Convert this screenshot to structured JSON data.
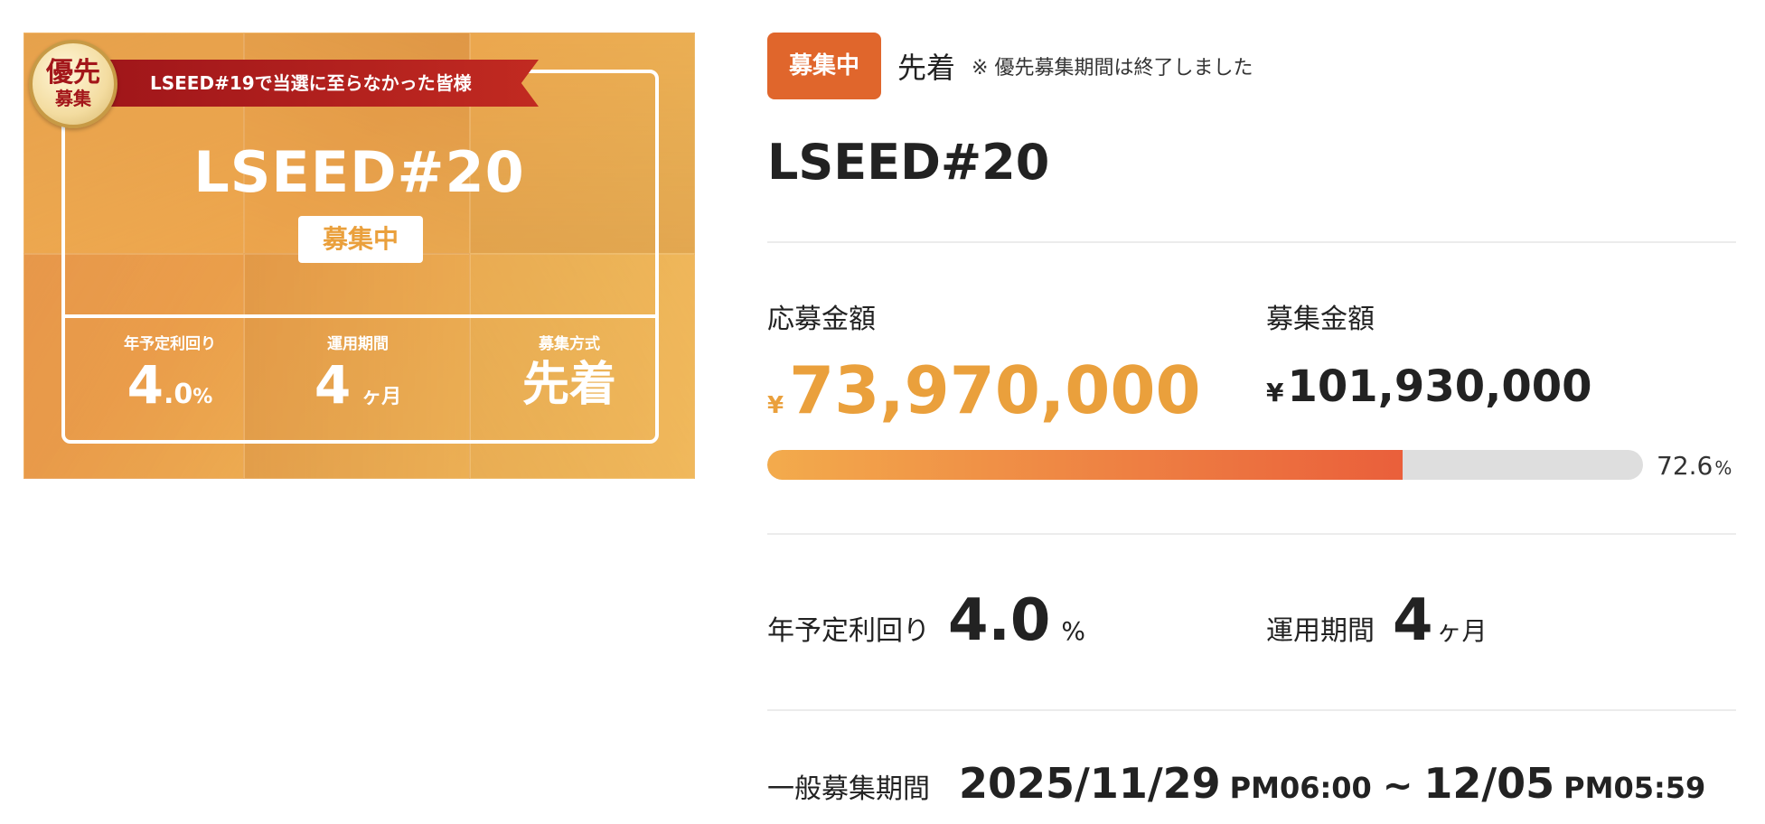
{
  "banner": {
    "priority_seal_top": "優先",
    "priority_seal_bottom": "募集",
    "ribbon_text": "LSEED#19で当選に至らなかった皆様",
    "title": "LSEED#20",
    "status_badge": "募集中",
    "stats": [
      {
        "label": "年予定利回り",
        "value_int": "4",
        "value_dec": ".0",
        "unit": "%"
      },
      {
        "label": "運用期間",
        "value": "4",
        "unit": "ヶ月"
      },
      {
        "label": "募集方式",
        "value": "先着"
      }
    ]
  },
  "detail": {
    "status_badge": "募集中",
    "method": "先着",
    "note": "※ 優先募集期間は終了しました",
    "fund_name": "LSEED#20",
    "applied_label": "応募金額",
    "applied_currency": "¥",
    "applied_amount": "73,970,000",
    "target_label": "募集金額",
    "target_currency": "¥",
    "target_amount": "101,930,000",
    "progress_value": "72.6",
    "progress_unit": "%",
    "yield_label": "年予定利回り",
    "yield_value": "4.0",
    "yield_unit": "%",
    "term_label": "運用期間",
    "term_value": "4",
    "term_unit": "ヶ月",
    "period_label": "一般募集期間",
    "period_start_date": "2025/11/29",
    "period_start_time": "PM06:00",
    "period_separator": "~",
    "period_end_date": "12/05",
    "period_end_time": "PM05:59"
  },
  "colors": {
    "accent": "#eaa03c",
    "status_badge": "#e0662c",
    "progress_start": "#f3ab4c",
    "progress_end": "#ea5f3b",
    "ribbon": "#a0161a"
  }
}
